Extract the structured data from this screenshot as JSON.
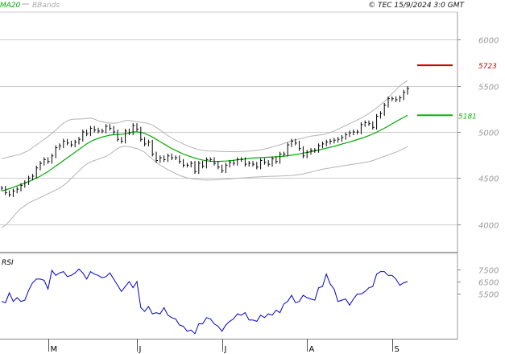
{
  "header": {
    "legend": [
      {
        "label": "MA20",
        "color": "#00aa00"
      },
      {
        "label": "BBands",
        "color": "#aaaaaa"
      }
    ],
    "source": "© TEC 15/9/2024 3:0 GMT"
  },
  "levels": {
    "resistance": {
      "label": "5723",
      "value": 5723,
      "color": "#cc0000"
    },
    "support": {
      "label": "5181",
      "value": 5181,
      "color": "#00bb00"
    }
  },
  "rsi_panel": {
    "title": "RSI",
    "color": "#0000cc"
  },
  "colors": {
    "price": "#000000",
    "ma": "#00aa00",
    "bbands": "#b4b4b4",
    "grid": "#cccccc",
    "axis": "#888888"
  },
  "chart_data": {
    "type": "line",
    "title": "",
    "x_labels": [
      "M",
      "J",
      "J",
      "A",
      "S"
    ],
    "x_label_index": [
      12,
      35,
      57,
      79,
      101
    ],
    "y_ticks_price": [
      "4000",
      "4500",
      "5000",
      "5500",
      "6000"
    ],
    "y_tick_values_price": [
      4000,
      4500,
      5000,
      5500,
      6000
    ],
    "y_range_price": [
      3700,
      6300
    ],
    "y_ticks_rsi": [
      "5500",
      "6500",
      "7500"
    ],
    "y_tick_values_rsi": [
      55,
      65,
      75
    ],
    "y_range_rsi": [
      19,
      87
    ],
    "series": [
      {
        "name": "MA20",
        "values": [
          4360,
          4370,
          4385,
          4400,
          4415,
          4430,
          4445,
          4462,
          4480,
          4500,
          4520,
          4545,
          4570,
          4600,
          4630,
          4660,
          4690,
          4720,
          4750,
          4780,
          4810,
          4840,
          4870,
          4895,
          4915,
          4930,
          4945,
          4955,
          4965,
          4970,
          4972,
          4975,
          4980,
          4990,
          5000,
          5000,
          4995,
          4985,
          4965,
          4945,
          4920,
          4895,
          4870,
          4845,
          4820,
          4800,
          4780,
          4760,
          4745,
          4730,
          4717,
          4705,
          4695,
          4688,
          4683,
          4681,
          4681,
          4682,
          4684,
          4688,
          4693,
          4698,
          4703,
          4708,
          4713,
          4717,
          4720,
          4722,
          4724,
          4726,
          4728,
          4730,
          4733,
          4737,
          4742,
          4748,
          4755,
          4762,
          4770,
          4778,
          4786,
          4795,
          4804,
          4814,
          4824,
          4834,
          4845,
          4856,
          4868,
          4880,
          4892,
          4904,
          4917,
          4930,
          4945,
          4960,
          4978,
          4997,
          5018,
          5040,
          5063,
          5088,
          5112,
          5135,
          5158,
          5181
        ]
      },
      {
        "name": "BBands upper",
        "values": [
          4710,
          4720,
          4730,
          4740,
          4750,
          4760,
          4780,
          4800,
          4830,
          4860,
          4890,
          4920,
          4950,
          4985,
          5020,
          5060,
          5095,
          5120,
          5135,
          5140,
          5140,
          5142,
          5146,
          5150,
          5140,
          5120,
          5110,
          5100,
          5095,
          5095,
          5098,
          5110,
          5125,
          5125,
          5118,
          5110,
          5105,
          5100,
          5090,
          5075,
          5050,
          5020,
          4990,
          4960,
          4935,
          4910,
          4890,
          4870,
          4850,
          4835,
          4820,
          4810,
          4800,
          4795,
          4793,
          4792,
          4790,
          4788,
          4787,
          4786,
          4786,
          4787,
          4789,
          4790,
          4792,
          4795,
          4800,
          4806,
          4815,
          4825,
          4838,
          4850,
          4860,
          4875,
          4890,
          4905,
          4915,
          4925,
          4935,
          4945,
          4955,
          4960,
          4965,
          4970,
          4980,
          4995,
          5010,
          5030,
          5050,
          5070,
          5090,
          5110,
          5130,
          5150,
          5175,
          5200,
          5230,
          5260,
          5295,
          5330,
          5370,
          5415,
          5455,
          5500,
          5530,
          5560
        ]
      },
      {
        "name": "BBands lower",
        "values": [
          3960,
          3990,
          4030,
          4080,
          4130,
          4170,
          4200,
          4230,
          4250,
          4270,
          4290,
          4310,
          4330,
          4350,
          4370,
          4390,
          4420,
          4455,
          4495,
          4535,
          4575,
          4620,
          4650,
          4675,
          4690,
          4705,
          4720,
          4735,
          4760,
          4790,
          4820,
          4840,
          4845,
          4840,
          4830,
          4820,
          4800,
          4780,
          4740,
          4705,
          4670,
          4640,
          4615,
          4590,
          4570,
          4550,
          4530,
          4515,
          4503,
          4495,
          4490,
          4485,
          4480,
          4478,
          4478,
          4480,
          4482,
          4485,
          4488,
          4492,
          4495,
          4498,
          4500,
          4503,
          4506,
          4509,
          4512,
          4514,
          4516,
          4518,
          4519,
          4520,
          4522,
          4524,
          4526,
          4528,
          4532,
          4538,
          4545,
          4555,
          4565,
          4575,
          4585,
          4595,
          4603,
          4610,
          4617,
          4624,
          4631,
          4637,
          4643,
          4650,
          4656,
          4663,
          4670,
          4678,
          4690,
          4705,
          4720,
          4735,
          4750,
          4765,
          4780,
          4800,
          4820,
          4840
        ]
      },
      {
        "name": "Price",
        "values": [
          4390,
          4340,
          4320,
          4360,
          4380,
          4420,
          4450,
          4500,
          4520,
          4610,
          4660,
          4700,
          4680,
          4740,
          4830,
          4850,
          4900,
          4880,
          4860,
          4890,
          4920,
          5000,
          4980,
          5040,
          5020,
          5010,
          5010,
          5060,
          5040,
          5000,
          4920,
          4900,
          5010,
          4990,
          5070,
          5030,
          4920,
          4870,
          4890,
          4760,
          4690,
          4720,
          4700,
          4740,
          4720,
          4720,
          4680,
          4640,
          4640,
          4660,
          4570,
          4660,
          4630,
          4700,
          4700,
          4660,
          4620,
          4580,
          4640,
          4670,
          4660,
          4700,
          4700,
          4650,
          4660,
          4650,
          4620,
          4690,
          4670,
          4650,
          4710,
          4680,
          4760,
          4760,
          4860,
          4900,
          4880,
          4820,
          4740,
          4780,
          4800,
          4800,
          4850,
          4870,
          4890,
          4900,
          4910,
          4920,
          4940,
          4970,
          4990,
          5000,
          5000,
          5080,
          5100,
          5090,
          5050,
          5170,
          5200,
          5290,
          5360,
          5360,
          5350,
          5370,
          5430,
          5470
        ]
      },
      {
        "name": "RSI",
        "values": [
          49,
          48,
          56,
          49,
          52,
          49,
          50,
          58,
          64,
          67,
          67,
          66,
          59,
          74,
          70,
          72,
          73,
          69,
          70,
          72,
          75,
          72,
          67,
          73,
          71,
          70,
          68,
          69,
          72,
          67,
          62,
          57,
          61,
          65,
          60,
          65,
          44,
          41,
          45,
          39,
          40,
          39,
          44,
          38,
          36,
          35,
          30,
          29,
          25,
          26,
          23,
          31,
          31,
          36,
          35,
          31,
          29,
          25,
          30,
          33,
          35,
          39,
          38,
          40,
          34,
          34,
          33,
          38,
          36,
          39,
          38,
          42,
          40,
          47,
          49,
          54,
          48,
          49,
          54,
          52,
          51,
          50,
          60,
          61,
          71,
          63,
          59,
          49,
          50,
          51,
          46,
          51,
          55,
          55,
          57,
          60,
          61,
          71,
          73,
          73,
          70,
          70,
          67,
          62,
          64,
          65
        ]
      }
    ]
  }
}
